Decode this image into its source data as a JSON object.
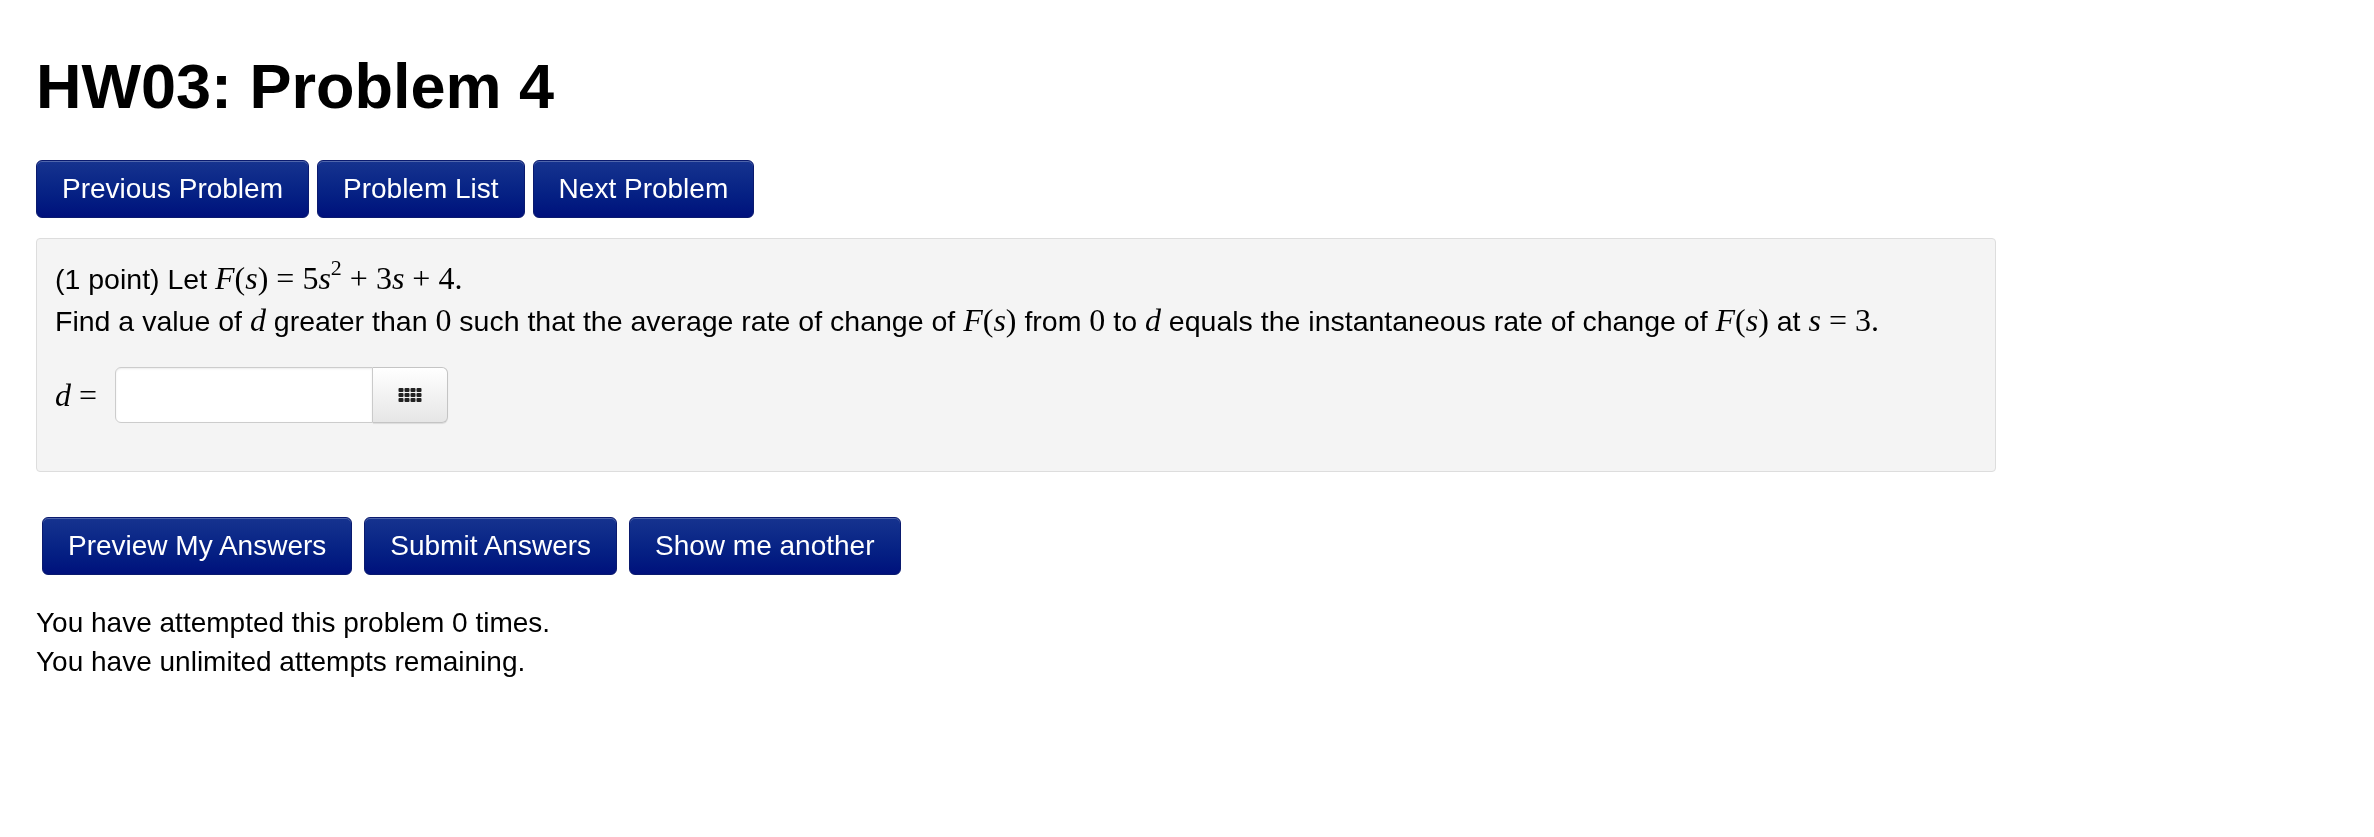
{
  "title": "HW03: Problem 4",
  "nav_buttons": [
    "Previous Problem",
    "Problem List",
    "Next Problem"
  ],
  "problem": {
    "lines": [
      [
        {
          "kind": "text",
          "text": "(1 point) Let "
        },
        {
          "kind": "var",
          "text": "F"
        },
        {
          "kind": "num",
          "text": "("
        },
        {
          "kind": "var",
          "text": "s"
        },
        {
          "kind": "num",
          "text": ") = 5"
        },
        {
          "kind": "var",
          "text": "s"
        },
        {
          "kind": "sup",
          "text": "2"
        },
        {
          "kind": "num",
          "text": " + 3"
        },
        {
          "kind": "var",
          "text": "s"
        },
        {
          "kind": "num",
          "text": " + 4."
        }
      ],
      [
        {
          "kind": "text",
          "text": "Find a value of "
        },
        {
          "kind": "var",
          "text": "d"
        },
        {
          "kind": "text",
          "text": " greater than "
        },
        {
          "kind": "num",
          "text": "0"
        },
        {
          "kind": "text",
          "text": " such that the average rate of change of "
        },
        {
          "kind": "var",
          "text": "F"
        },
        {
          "kind": "num",
          "text": "("
        },
        {
          "kind": "var",
          "text": "s"
        },
        {
          "kind": "num",
          "text": ")"
        },
        {
          "kind": "text",
          "text": " from "
        },
        {
          "kind": "num",
          "text": "0"
        },
        {
          "kind": "text",
          "text": " to "
        },
        {
          "kind": "var",
          "text": "d"
        },
        {
          "kind": "text",
          "text": " equals the instantaneous rate of change of "
        },
        {
          "kind": "var",
          "text": "F"
        },
        {
          "kind": "num",
          "text": "("
        },
        {
          "kind": "var",
          "text": "s"
        },
        {
          "kind": "num",
          "text": ")"
        },
        {
          "kind": "text",
          "text": " at "
        },
        {
          "kind": "var",
          "text": "s"
        },
        {
          "kind": "num",
          "text": " = 3."
        }
      ]
    ],
    "answer": {
      "label": [
        {
          "kind": "var",
          "text": "d"
        },
        {
          "kind": "num",
          "text": " ="
        }
      ]
    }
  },
  "action_buttons": [
    "Preview My Answers",
    "Submit Answers",
    "Show me another"
  ],
  "status": [
    "You have attempted this problem 0 times.",
    "You have unlimited attempts remaining."
  ]
}
